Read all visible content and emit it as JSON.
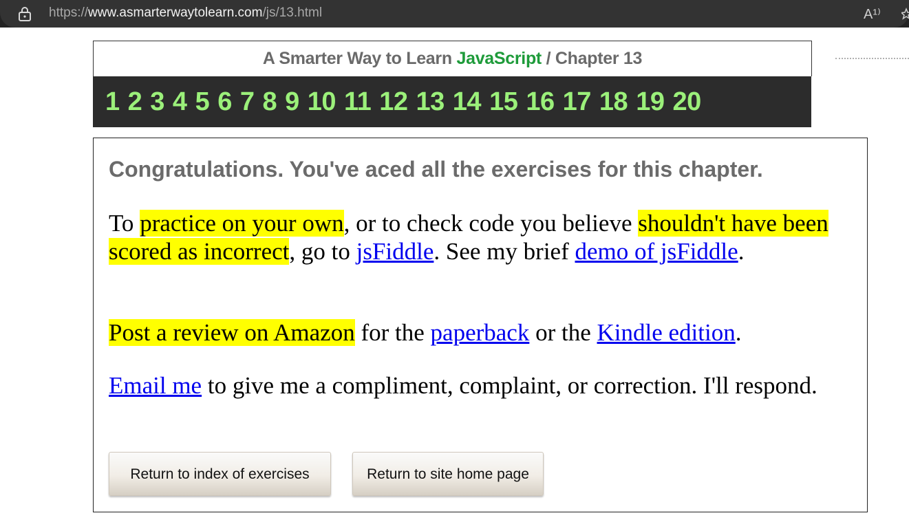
{
  "browser": {
    "url_prefix": "https://",
    "url_host": "www.asmarterwaytolearn.com",
    "url_path": "/js/13.html",
    "lock_icon": "lock-icon",
    "read_aloud_icon": "read-aloud-icon",
    "read_aloud_glyph": "A¹⁾"
  },
  "header": {
    "prefix": "A Smarter Way to Learn",
    "language": "JavaScript",
    "separator": "/",
    "chapter": "Chapter 13",
    "language_color": "#1e9b3a"
  },
  "chapters": [
    "1",
    "2",
    "3",
    "4",
    "5",
    "6",
    "7",
    "8",
    "9",
    "10",
    "11",
    "12",
    "13",
    "14",
    "15",
    "16",
    "17",
    "18",
    "19",
    "20"
  ],
  "content": {
    "congrats": "Congratulations. You've aced all the exercises for this chapter.",
    "p1": {
      "t1": "To ",
      "h1": "practice on your own",
      "t2": ", or to check code you believe ",
      "h2": "shouldn't have been scored as incorrect",
      "t3": ", go to ",
      "l1": "jsFiddle",
      "t4": ". See my brief ",
      "l2": "demo of jsFiddle",
      "t5": "."
    },
    "p2": {
      "h1": "Post a review on Amazon",
      "t1": " for the ",
      "l1": "paperback",
      "t2": " or the ",
      "l2": "Kindle edition",
      "t3": "."
    },
    "p3": {
      "l1": "Email me",
      "t1": " to give me a compliment, complaint, or correction. I'll respond."
    },
    "buttons": {
      "index": "Return to index of exercises",
      "home": "Return to site home page"
    }
  },
  "colors": {
    "highlight": "#ffff00",
    "link": "#0000ee",
    "nav_number": "#9bf07a",
    "nav_bg": "#2c2c2c"
  }
}
